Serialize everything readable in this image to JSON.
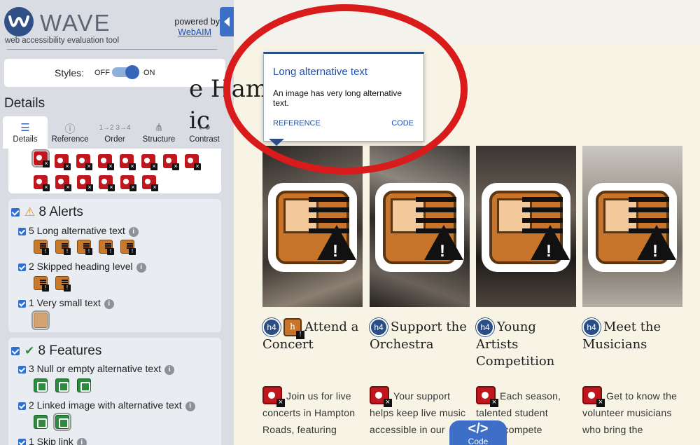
{
  "wave": {
    "brand_word": "WAVE",
    "tagline": "web accessibility evaluation tool",
    "powered_by": "powered by",
    "webaim_link": "WebAIM",
    "styles_label": "Styles:",
    "styles_off": "OFF",
    "styles_on": "ON",
    "styles_on_state": true,
    "details_title": "Details",
    "tabs": [
      {
        "label": "Details",
        "icon": "list-icon",
        "active": true
      },
      {
        "label": "Reference",
        "icon": "info-icon",
        "active": false
      },
      {
        "label": "Order",
        "icon": "order-icon",
        "active": false
      },
      {
        "label": "Structure",
        "icon": "structure-icon",
        "active": false
      },
      {
        "label": "Contrast",
        "icon": "contrast-icon",
        "active": false
      }
    ],
    "alerts": {
      "count_label": "8 Alerts",
      "items": [
        {
          "label": "5 Long alternative text"
        },
        {
          "label": "2 Skipped heading level"
        },
        {
          "label": "1 Very small text"
        }
      ]
    },
    "features": {
      "count_label": "8 Features",
      "items": [
        {
          "label": "3 Null or empty alternative text"
        },
        {
          "label": "2 Linked image with alternative text"
        },
        {
          "label": "1 Skip link"
        }
      ]
    }
  },
  "tooltip": {
    "title": "Long alternative text",
    "description": "An image has very long alternative text.",
    "reference_link": "REFERENCE",
    "code_link": "CODE"
  },
  "page": {
    "hero_line1": "e Hampton Roads",
    "hero_line2": "ic",
    "cards": [
      {
        "badge": "h4",
        "heading": "Attend a Concert",
        "body": "Join us for live concerts in Hampton Roads, featuring"
      },
      {
        "badge": "h4",
        "heading": "Support the Orchestra",
        "body": "Your support helps keep live music accessible in our"
      },
      {
        "badge": "h4",
        "heading": "Young Artists Competition",
        "body": "Each season, talented student ...ans compete"
      },
      {
        "badge": "h4",
        "heading": "Meet the Musicians",
        "body": "Get to know the volunteer musicians who bring the"
      }
    ],
    "code_toggle_label": "Code",
    "code_toggle_icon": "code-icon"
  },
  "colors": {
    "wave_blue": "#3566b8",
    "error_red": "#c0171e",
    "alert_orange": "#c8752b",
    "feature_green": "#2d8a3e",
    "annotation_red": "#d91b1b"
  }
}
